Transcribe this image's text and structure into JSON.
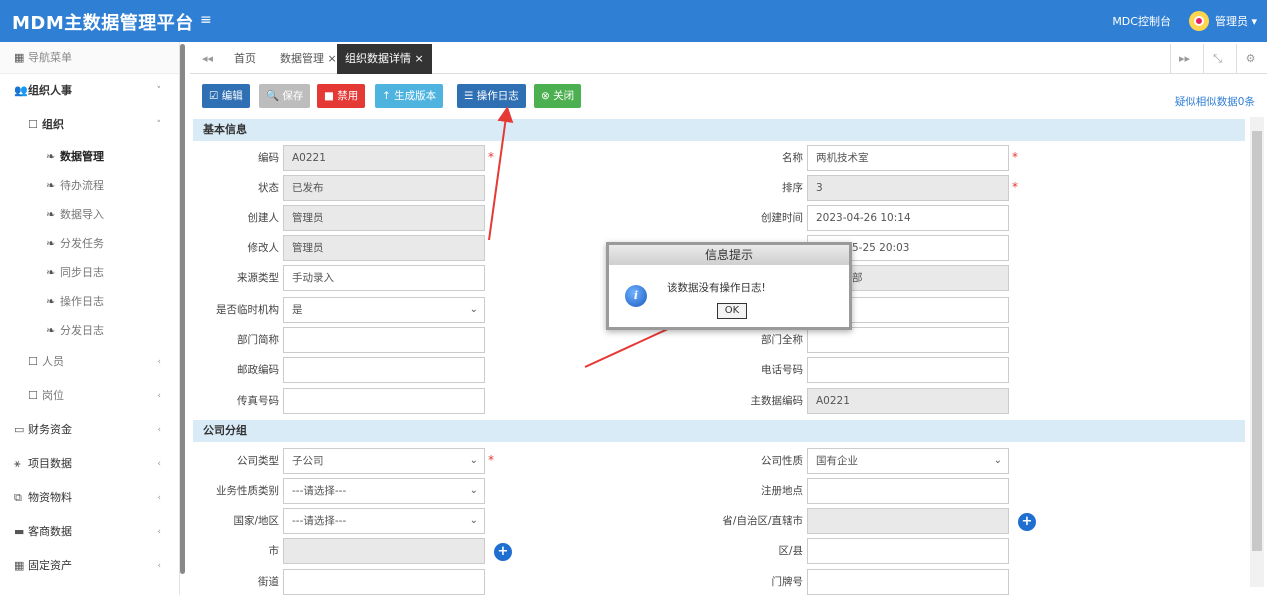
{
  "header": {
    "brand": "MDM主数据管理平台",
    "menu_icon": "≡",
    "console": "MDC控制台",
    "user": "管理员 ▾"
  },
  "sidebar": {
    "title": "导航菜单",
    "groups": [
      {
        "label": "组织人事",
        "arrow": "˅"
      },
      {
        "label": "组织",
        "arrow": "˅"
      },
      {
        "label": "人员",
        "arrow": "‹"
      },
      {
        "label": "岗位",
        "arrow": "‹"
      },
      {
        "label": "财务资金",
        "arrow": "‹"
      },
      {
        "label": "项目数据",
        "arrow": "‹"
      },
      {
        "label": "物资物料",
        "arrow": "‹"
      },
      {
        "label": "客商数据",
        "arrow": "‹"
      },
      {
        "label": "固定资产",
        "arrow": "‹"
      }
    ],
    "leaves": [
      "数据管理",
      "待办流程",
      "数据导入",
      "分发任务",
      "同步日志",
      "操作日志",
      "分发日志"
    ]
  },
  "tabs": {
    "back": "◂◂",
    "items": [
      "首页",
      "数据管理 ×",
      "组织数据详情 ×"
    ],
    "fwd": "▸▸",
    "fullscreen": "⤡",
    "settings": "⚙"
  },
  "toolbar": {
    "edit": "☑ 编辑",
    "save": "🔍 保存",
    "disable": "■ 禁用",
    "gen_version": "↑ 生成版本",
    "log": "☰ 操作日志",
    "close": "⊗ 关闭",
    "similar": "疑似相似数据0条"
  },
  "sections": {
    "basic": "基本信息",
    "company": "公司分组"
  },
  "form": {
    "code_l": "编码",
    "code_v": "A0221",
    "name_l": "名称",
    "name_v": "两机技术室",
    "status_l": "状态",
    "status_v": "已发布",
    "sort_l": "排序",
    "sort_v": "3",
    "creator_l": "创建人",
    "creator_v": "管理员",
    "ctime_l": "创建时间",
    "ctime_v": "2023-04-26 10:14",
    "modifier_l": "修改人",
    "modifier_v": "管理员",
    "mtime_v": "5-25 20:03",
    "source_l": "来源类型",
    "source_v": "手动录入",
    "dept_v": "部",
    "temp_l": "是否临时机构",
    "temp_v": "是",
    "short_l": "部门简称",
    "full_l": "部门全称",
    "postal_l": "邮政编码",
    "phone_l": "电话号码",
    "fax_l": "传真号码",
    "mcode_l": "主数据编码",
    "mcode_v": "A0221",
    "ctype_l": "公司类型",
    "ctype_v": "子公司",
    "cnature_l": "公司性质",
    "cnature_v": "国有企业",
    "biz_l": "业务性质类别",
    "biz_v": "---请选择---",
    "reg_l": "注册地点",
    "country_l": "国家/地区",
    "country_v": "---请选择---",
    "prov_l": "省/自治区/直辖市",
    "city_l": "市",
    "county_l": "区/县",
    "street_l": "街道",
    "door_l": "门牌号"
  },
  "dialog": {
    "title": "信息提示",
    "message": "该数据没有操作日志!",
    "ok": "OK",
    "icon": "i"
  },
  "colors": {
    "header": "#2f7fd4",
    "edit": "#2f6fb3",
    "save": "#bdbdbd",
    "disable": "#e53935",
    "gen": "#4fb3e0",
    "log": "#2f6fb3",
    "close": "#4caf50",
    "arrow": "#e53935"
  }
}
